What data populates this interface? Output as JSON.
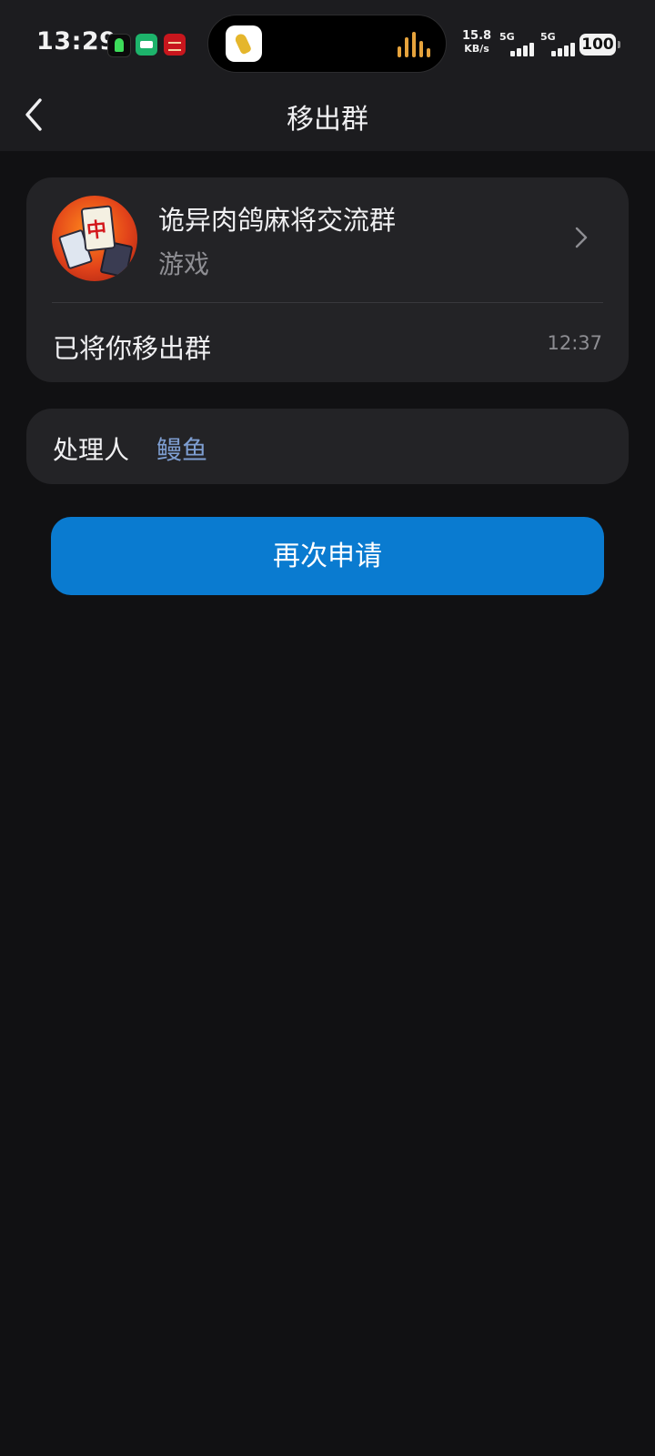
{
  "status_bar": {
    "time": "13:29",
    "net_speed_value": "15.8",
    "net_speed_unit": "KB/s",
    "signal1_label": "5G",
    "signal2_label": "5G",
    "battery": "100"
  },
  "nav": {
    "title": "移出群"
  },
  "group": {
    "name": "诡异肉鸽麻将交流群",
    "category": "游戏",
    "event_text": "已将你移出群",
    "event_time": "12:37"
  },
  "handler": {
    "label": "处理人",
    "name": "鳗鱼"
  },
  "actions": {
    "reapply_label": "再次申请"
  },
  "colors": {
    "primary_button": "#0a7bd0",
    "link": "#7e9ed1",
    "card": "#232326",
    "background": "#111113"
  }
}
